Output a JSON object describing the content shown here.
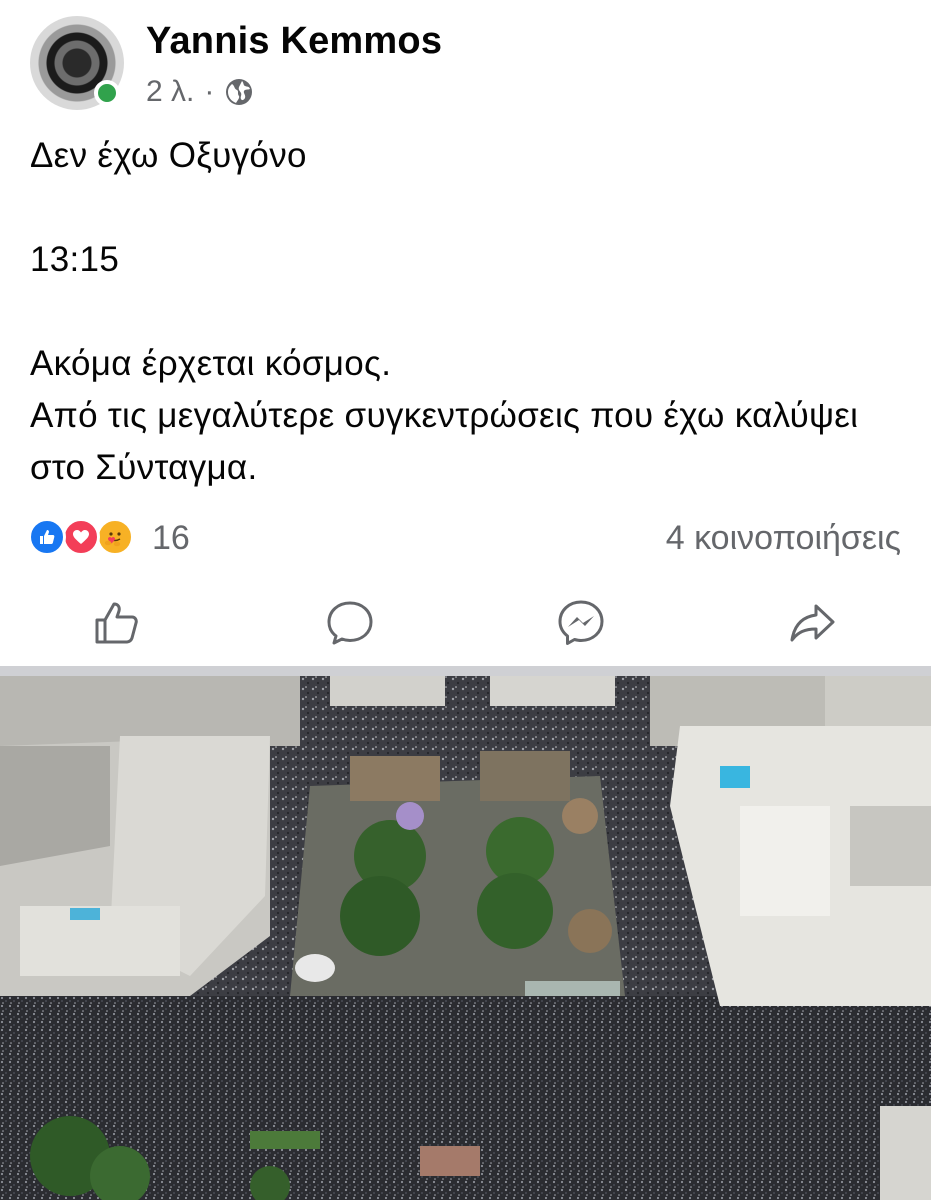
{
  "post": {
    "author": "Yannis Kemmos",
    "time": "2 λ.",
    "separator": "·",
    "privacy_icon": "globe-icon",
    "text": {
      "line1": "Δεν έχω Οξυγόνο",
      "line2": "13:15",
      "line3": "Ακόμα έρχεται κόσμος.",
      "line4": "Από τις μεγαλύτερε συγκεντρώσεις που έχω καλύψει στο Σύνταγμα."
    }
  },
  "engagement": {
    "reaction_icons": [
      "like-icon",
      "love-icon",
      "care-icon"
    ],
    "reaction_count": "16",
    "shares": "4 κοινοποιήσεις"
  },
  "actions": [
    {
      "name": "like",
      "icon": "thumbs-up-icon"
    },
    {
      "name": "comment",
      "icon": "comment-icon"
    },
    {
      "name": "send",
      "icon": "messenger-icon"
    },
    {
      "name": "share",
      "icon": "share-icon"
    }
  ],
  "colors": {
    "online": "#31a24c",
    "like": "#1877f2",
    "love": "#f33e58",
    "care": "#f7b125",
    "secondary_text": "#65676b"
  }
}
